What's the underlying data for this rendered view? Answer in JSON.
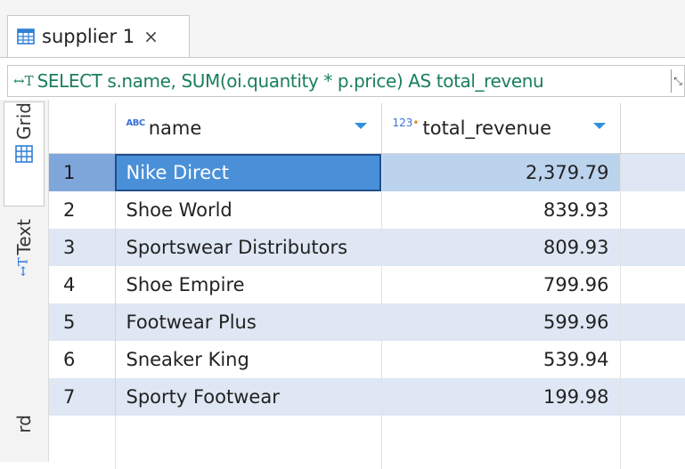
{
  "tab": {
    "label": "supplier 1",
    "close": "×",
    "icon": "table-icon"
  },
  "query": {
    "icon": "text-icon",
    "text": "SELECT s.name, SUM(oi.quantity * p.price) AS total_revenu"
  },
  "side_tabs": {
    "grid": "Grid",
    "text": "Text",
    "bottom": "rd"
  },
  "columns": [
    {
      "type_badge": "ABC",
      "label": "name"
    },
    {
      "type_badge": "123",
      "label": "total_revenue"
    }
  ],
  "rows": [
    {
      "num": "1",
      "name": "Nike Direct",
      "revenue": "2,379.79"
    },
    {
      "num": "2",
      "name": "Shoe World",
      "revenue": "839.93"
    },
    {
      "num": "3",
      "name": "Sportswear Distributors",
      "revenue": "809.93"
    },
    {
      "num": "4",
      "name": "Shoe Empire",
      "revenue": "799.96"
    },
    {
      "num": "5",
      "name": "Footwear Plus",
      "revenue": "599.96"
    },
    {
      "num": "6",
      "name": "Sneaker King",
      "revenue": "539.94"
    },
    {
      "num": "7",
      "name": "Sporty Footwear",
      "revenue": "199.98"
    }
  ],
  "selected_row": "1",
  "colors": {
    "selected_cell": "#4a90d9",
    "alt_row": "#dee7f3",
    "sql_text": "#1a7f5a",
    "sort_arrow": "#2f8fe0"
  }
}
